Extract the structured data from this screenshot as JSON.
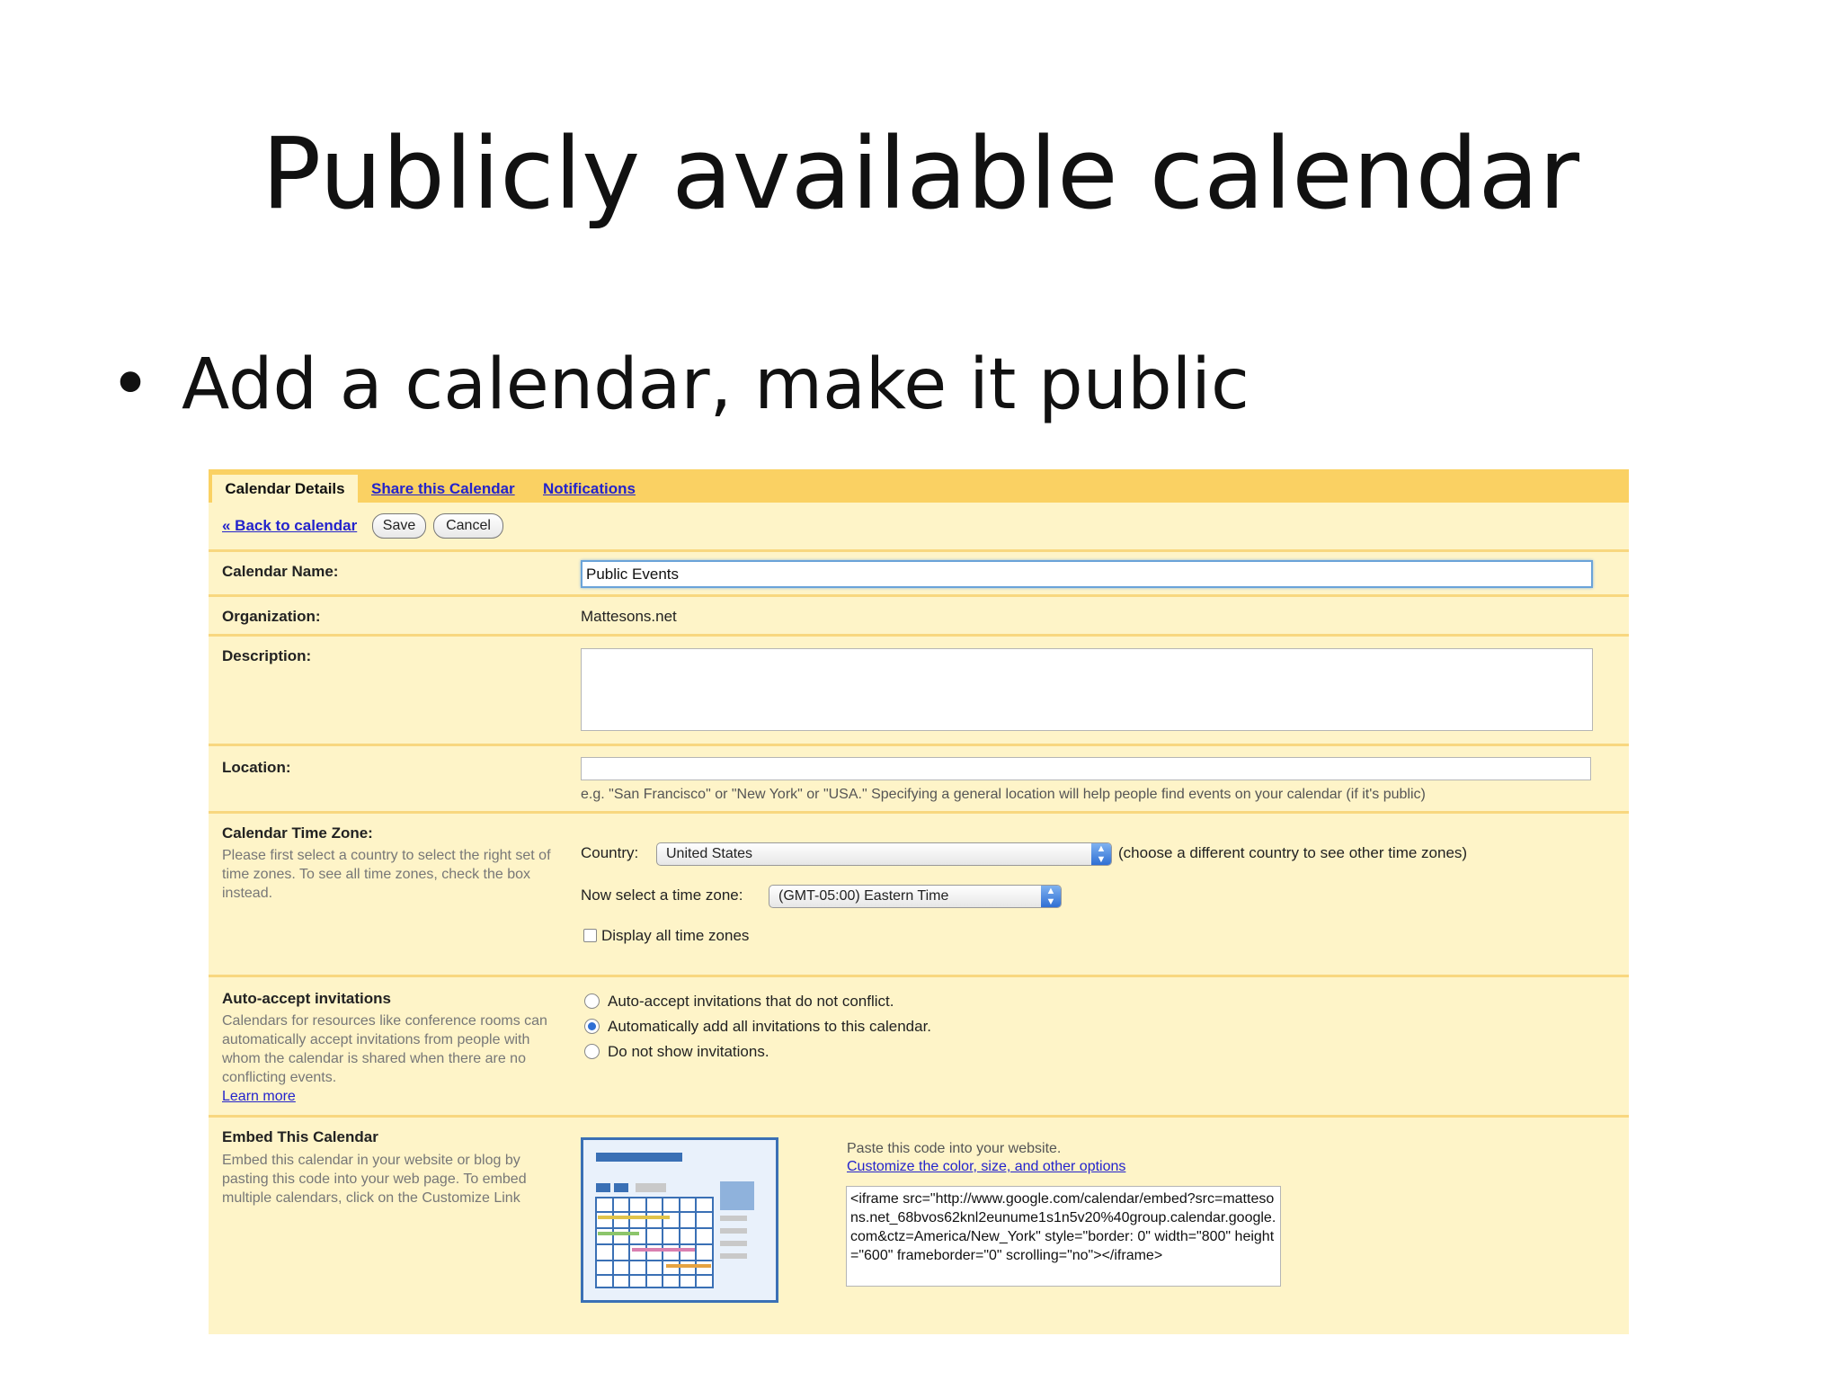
{
  "slide": {
    "title": "Publicly available calendar",
    "bullet": "Add a calendar, make it public"
  },
  "tabs": {
    "active": "Calendar Details",
    "share": "Share this Calendar",
    "notifications": "Notifications"
  },
  "toolbar": {
    "back": "« Back to calendar",
    "save": "Save",
    "cancel": "Cancel"
  },
  "fields": {
    "name_label": "Calendar Name:",
    "name_value": "Public Events",
    "org_label": "Organization:",
    "org_value": "Mattesons.net",
    "desc_label": "Description:",
    "desc_value": "",
    "location_label": "Location:",
    "location_value": "",
    "location_hint": "e.g. \"San Francisco\" or \"New York\" or \"USA.\" Specifying a general location will help people find events on your calendar (if it's public)"
  },
  "timezone": {
    "label": "Calendar Time Zone:",
    "help": "Please first select a country to select the right set of time zones. To see all time zones, check the box instead.",
    "country_label": "Country:",
    "country_value": "United States",
    "country_hint": "(choose a different country to see other time zones)",
    "zone_label": "Now select a time zone:",
    "zone_value": "(GMT-05:00) Eastern Time",
    "display_all": "Display all time zones"
  },
  "autoaccept": {
    "label": "Auto-accept invitations",
    "help": "Calendars for resources like conference rooms can automatically accept invitations from people with whom the calendar is shared when there are no conflicting events.",
    "learn_more": "Learn more",
    "options": [
      "Auto-accept invitations that do not conflict.",
      "Automatically add all invitations to this calendar.",
      "Do not show invitations."
    ]
  },
  "embed": {
    "label": "Embed This Calendar",
    "help": "Embed this calendar in your website or blog by pasting this code into your web page. To embed multiple calendars, click on the Customize Link",
    "paste_text": "Paste this code into your website.",
    "customize_link": "Customize the color, size, and other options",
    "code": "<iframe src=\"http://www.google.com/calendar/embed?src=mattesons.net_68bvos62knl2eunume1s1n5v20%40group.calendar.google.com&ctz=America/New_York\" style=\"border: 0\" width=\"800\" height=\"600\" frameborder=\"0\" scrolling=\"no\"></iframe>"
  }
}
